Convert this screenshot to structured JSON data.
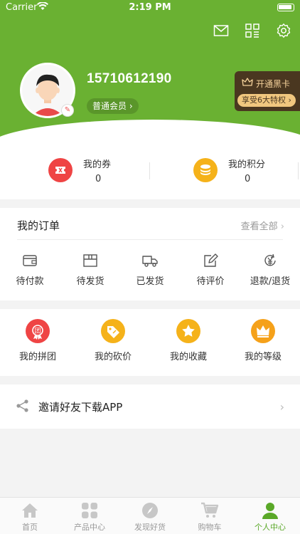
{
  "status_bar": {
    "carrier": "Carrier",
    "time": "2:19 PM"
  },
  "profile": {
    "phone": "15710612190",
    "member_level": "普通会员",
    "vip_title": "开通黑卡",
    "vip_subtitle": "享受6大特权"
  },
  "header_icons": [
    "mail-icon",
    "qr-scan-icon",
    "settings-icon"
  ],
  "stats": [
    {
      "label": "我的券",
      "value": "0",
      "icon": "coupon-icon",
      "color": "#ef4444"
    },
    {
      "label": "我的积分",
      "value": "0",
      "icon": "coins-icon",
      "color": "#f5b21a"
    }
  ],
  "orders": {
    "title": "我的订单",
    "view_all": "查看全部",
    "items": [
      {
        "label": "待付款",
        "icon": "wallet-icon"
      },
      {
        "label": "待发货",
        "icon": "package-icon"
      },
      {
        "label": "已发货",
        "icon": "truck-icon"
      },
      {
        "label": "待评价",
        "icon": "edit-icon"
      },
      {
        "label": "退款/退货",
        "icon": "refund-icon"
      }
    ]
  },
  "tools": [
    {
      "label": "我的拼团",
      "icon": "group-buy-icon",
      "color": "#ef4444"
    },
    {
      "label": "我的砍价",
      "icon": "bargain-tag-icon",
      "color": "#f5b21a"
    },
    {
      "label": "我的收藏",
      "icon": "star-icon",
      "color": "#f5b21a"
    },
    {
      "label": "我的等级",
      "icon": "crown-icon",
      "color": "#f5a11a"
    }
  ],
  "invite": {
    "label": "邀请好友下载APP"
  },
  "tabs": [
    {
      "label": "首页",
      "icon": "home-icon"
    },
    {
      "label": "产品中心",
      "icon": "grid-icon"
    },
    {
      "label": "发现好货",
      "icon": "compass-icon"
    },
    {
      "label": "购物车",
      "icon": "cart-icon"
    },
    {
      "label": "个人中心",
      "icon": "user-icon",
      "active": true
    }
  ],
  "colors": {
    "brand_green": "#6ab132",
    "active_tab": "#5aa828"
  }
}
